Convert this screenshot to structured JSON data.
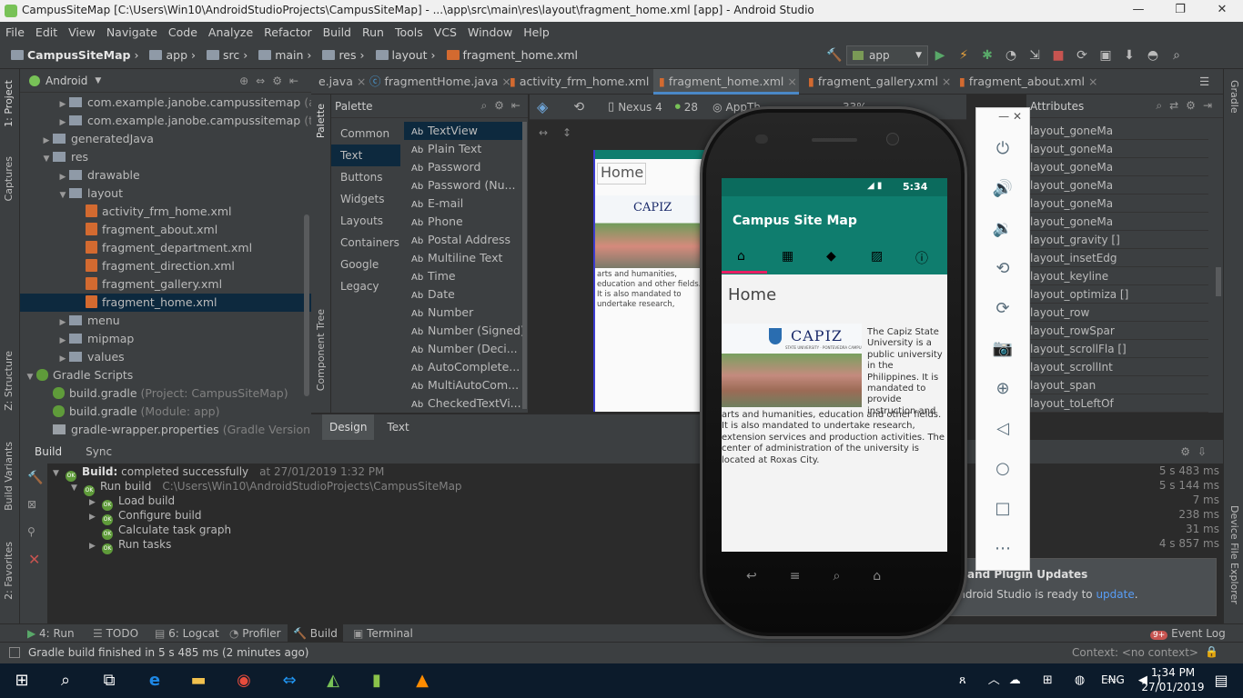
{
  "window": {
    "title": "CampusSiteMap [C:\\Users\\Win10\\AndroidStudioProjects\\CampusSiteMap] - ...\\app\\src\\main\\res\\layout\\fragment_home.xml [app] - Android Studio"
  },
  "menu": [
    "File",
    "Edit",
    "View",
    "Navigate",
    "Code",
    "Analyze",
    "Refactor",
    "Build",
    "Run",
    "Tools",
    "VCS",
    "Window",
    "Help"
  ],
  "breadcrumb": [
    "CampusSiteMap",
    "app",
    "src",
    "main",
    "res",
    "layout",
    "fragment_home.xml"
  ],
  "run_config": "app",
  "project": {
    "view": "Android",
    "items": [
      {
        "label": "com.example.janobe.campussitemap",
        "note": "(androidTest)",
        "indent": 2,
        "kind": "folder",
        "arrow": "▶"
      },
      {
        "label": "com.example.janobe.campussitemap",
        "note": "(test)",
        "indent": 2,
        "kind": "folder",
        "arrow": "▶"
      },
      {
        "label": "generatedJava",
        "note": "",
        "indent": 1,
        "kind": "folder",
        "arrow": "▶"
      },
      {
        "label": "res",
        "note": "",
        "indent": 1,
        "kind": "folder",
        "arrow": "▼"
      },
      {
        "label": "drawable",
        "note": "",
        "indent": 2,
        "kind": "folder",
        "arrow": "▶"
      },
      {
        "label": "layout",
        "note": "",
        "indent": 2,
        "kind": "folder",
        "arrow": "▼"
      },
      {
        "label": "activity_frm_home.xml",
        "note": "",
        "indent": 3,
        "kind": "xml",
        "arrow": ""
      },
      {
        "label": "fragment_about.xml",
        "note": "",
        "indent": 3,
        "kind": "xml",
        "arrow": ""
      },
      {
        "label": "fragment_department.xml",
        "note": "",
        "indent": 3,
        "kind": "xml",
        "arrow": ""
      },
      {
        "label": "fragment_direction.xml",
        "note": "",
        "indent": 3,
        "kind": "xml",
        "arrow": ""
      },
      {
        "label": "fragment_gallery.xml",
        "note": "",
        "indent": 3,
        "kind": "xml",
        "arrow": ""
      },
      {
        "label": "fragment_home.xml",
        "note": "",
        "indent": 3,
        "kind": "xml",
        "arrow": "",
        "selected": true
      },
      {
        "label": "menu",
        "note": "",
        "indent": 2,
        "kind": "folder",
        "arrow": "▶"
      },
      {
        "label": "mipmap",
        "note": "",
        "indent": 2,
        "kind": "folder",
        "arrow": "▶"
      },
      {
        "label": "values",
        "note": "",
        "indent": 2,
        "kind": "folder",
        "arrow": "▶"
      },
      {
        "label": "Gradle Scripts",
        "note": "",
        "indent": 0,
        "kind": "gradle",
        "arrow": "▼"
      },
      {
        "label": "build.gradle",
        "note": "(Project: CampusSiteMap)",
        "indent": 1,
        "kind": "gradle",
        "arrow": ""
      },
      {
        "label": "build.gradle",
        "note": "(Module: app)",
        "indent": 1,
        "kind": "gradle",
        "arrow": ""
      },
      {
        "label": "gradle-wrapper.properties",
        "note": "(Gradle Version)",
        "indent": 1,
        "kind": "file",
        "arrow": ""
      }
    ]
  },
  "left_tabs": [
    "1: Project",
    "Captures",
    "Z: Structure",
    "Build Variants",
    "2: Favorites"
  ],
  "right_tabs": [
    "Gradle",
    "Device File Explorer"
  ],
  "editor_tabs": [
    {
      "label": "e.java"
    },
    {
      "label": "fragmentHome.java"
    },
    {
      "label": "activity_frm_home.xml"
    },
    {
      "label": "fragment_home.xml",
      "active": true
    },
    {
      "label": "fragment_gallery.xml"
    },
    {
      "label": "fragment_about.xml"
    }
  ],
  "palette": {
    "title": "Palette",
    "categories": [
      "Common",
      "Text",
      "Buttons",
      "Widgets",
      "Layouts",
      "Containers",
      "Google",
      "Legacy"
    ],
    "selected_category": "Text",
    "items": [
      "TextView",
      "Plain Text",
      "Password",
      "Password (Nu...",
      "E-mail",
      "Phone",
      "Postal Address",
      "Multiline Text",
      "Time",
      "Date",
      "Number",
      "Number (Signed)",
      "Number (Deci...",
      "AutoComplete...",
      "MultiAutoCom...",
      "CheckedTextVi..."
    ]
  },
  "component_tree_label": "Component Tree",
  "palette_strip_label": "Palette",
  "design_toolbar": {
    "device": "Nexus 4",
    "api": "28",
    "theme": "AppTh",
    "zoom": "33%"
  },
  "design_tabs": [
    "Design",
    "Text"
  ],
  "preview": {
    "title": "Home",
    "logo": "CAPIZ",
    "text": "arts and humanities, education and other fields. It is also mandated to undertake research, extension services and production activities. The center of administration of the university is located at Roxas City."
  },
  "attributes": {
    "title": "Attributes",
    "items": [
      "layout_goneMa",
      "layout_goneMa",
      "layout_goneMa",
      "layout_goneMa",
      "layout_goneMa",
      "layout_goneMa",
      "layout_gravity  []",
      "layout_insetEdg",
      "layout_keyline",
      "layout_optimiza []",
      "layout_row",
      "layout_rowSpar",
      "layout_scrollFla []",
      "layout_scrollInt",
      "layout_span",
      "layout_toLeftOf"
    ]
  },
  "build": {
    "tabs": [
      "Build",
      "Sync"
    ],
    "lines": [
      {
        "ind": 0,
        "bold": "Build:",
        "text": " completed successfully",
        "extra": "at 27/01/2019 1:32 PM",
        "time": "5 s 483 ms",
        "arrow": "▼"
      },
      {
        "ind": 1,
        "bold": "",
        "text": "Run build",
        "extra": "C:\\Users\\Win10\\AndroidStudioProjects\\CampusSiteMap",
        "time": "5 s 144 ms",
        "arrow": "▼"
      },
      {
        "ind": 2,
        "bold": "",
        "text": "Load build",
        "extra": "",
        "time": "7 ms",
        "arrow": "▶"
      },
      {
        "ind": 2,
        "bold": "",
        "text": "Configure build",
        "extra": "",
        "time": "238 ms",
        "arrow": "▶"
      },
      {
        "ind": 2,
        "bold": "",
        "text": "Calculate task graph",
        "extra": "",
        "time": "31 ms",
        "arrow": ""
      },
      {
        "ind": 2,
        "bold": "",
        "text": "Run tasks",
        "extra": "",
        "time": "4 s 857 ms",
        "arrow": "▶"
      }
    ]
  },
  "notification": {
    "title": "and Plugin Updates",
    "text": "Android Studio is ready to ",
    "link": "update",
    "end": "."
  },
  "bottom_tabs": [
    "4: Run",
    "TODO",
    "6: Logcat",
    "Profiler",
    "Build",
    "Terminal"
  ],
  "event_log": "Event Log",
  "event_count": "9+",
  "status": {
    "left": "Gradle build finished in 5 s 485 ms (2 minutes ago)",
    "right": "Context: <no context>"
  },
  "phone": {
    "status_time": "5:34",
    "app_title": "Campus Site Map",
    "fragment_title": "Home",
    "logo": "CAPIZ",
    "logo_sub": "STATE UNIVERSITY · PONTEVEDRA CAMPUS",
    "body_side": "The Capiz State University is a public university in the Philippines. It is mandated to provide instruction and",
    "body_rest": "arts and humanities, education and other fields. It is also mandated to undertake research, extension services and production activities. The center of administration of the university is located at Roxas City.",
    "colors": {
      "toolbar": "#0f7d6e",
      "accent": "#e91e63"
    }
  },
  "taskbar": {
    "time": "1:34 PM",
    "date": "27/01/2019",
    "lang": "ENG"
  }
}
